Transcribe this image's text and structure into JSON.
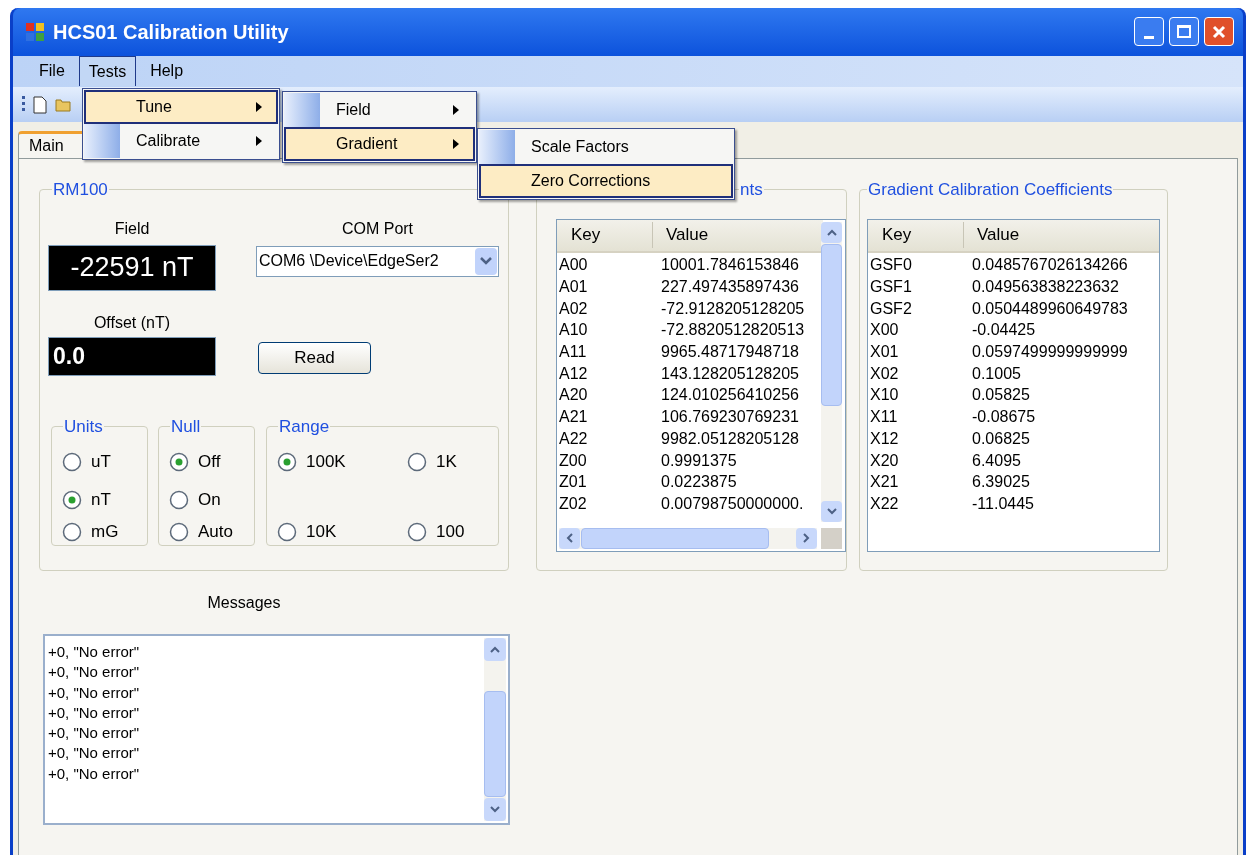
{
  "window": {
    "title": "HCS01 Calibration Utility"
  },
  "menu_bar": [
    {
      "label": "File",
      "selected": false
    },
    {
      "label": "Tests",
      "selected": true
    },
    {
      "label": "Help",
      "selected": false
    }
  ],
  "open_menus": [
    {
      "items": [
        {
          "label": "Tune",
          "selected": true,
          "submenu": true
        },
        {
          "label": "Calibrate",
          "selected": false,
          "submenu": true
        }
      ]
    },
    {
      "items": [
        {
          "label": "Field",
          "selected": false,
          "submenu": true
        },
        {
          "label": "Gradient",
          "selected": true,
          "submenu": true
        }
      ]
    },
    {
      "items": [
        {
          "label": "Scale Factors",
          "selected": false,
          "submenu": false
        },
        {
          "label": "Zero Corrections",
          "selected": true,
          "submenu": false
        }
      ]
    }
  ],
  "tabs": [
    {
      "label": "Main",
      "selected": true
    }
  ],
  "rm100": {
    "title": "RM100",
    "field_label": "Field",
    "field_value": "-22591 nT",
    "com_port_label": "COM Port",
    "com_port_value": "COM6 \\Device\\EdgeSer2",
    "offset_label": "Offset (nT)",
    "offset_value": "0.0",
    "read_button": "Read",
    "groups": [
      {
        "title": "Units",
        "options": [
          {
            "label": "uT",
            "selected": false
          },
          {
            "label": "nT",
            "selected": true
          },
          {
            "label": "mG",
            "selected": false
          }
        ]
      },
      {
        "title": "Null",
        "options": [
          {
            "label": "Off",
            "selected": true
          },
          {
            "label": "On",
            "selected": false
          },
          {
            "label": "Auto",
            "selected": false
          }
        ]
      },
      {
        "title": "Range",
        "options": [
          {
            "label": "100K",
            "selected": true
          },
          {
            "label": "1K",
            "selected": false
          },
          {
            "label": "10K",
            "selected": false
          },
          {
            "label": "100",
            "selected": false
          }
        ]
      }
    ]
  },
  "field_coefficients": {
    "title": "nts",
    "columns": [
      "Key",
      "Value"
    ],
    "rows": [
      [
        "A00",
        "10001.7846153846"
      ],
      [
        "A01",
        "227.497435897436"
      ],
      [
        "A02",
        "-72.9128205128205"
      ],
      [
        "A10",
        "-72.8820512820513"
      ],
      [
        "A11",
        "9965.48717948718"
      ],
      [
        "A12",
        "143.128205128205"
      ],
      [
        "A20",
        "124.010256410256"
      ],
      [
        "A21",
        "106.769230769231"
      ],
      [
        "A22",
        "9982.05128205128"
      ],
      [
        "Z00",
        "0.9991375"
      ],
      [
        "Z01",
        "0.0223875"
      ],
      [
        "Z02",
        "0.00798750000000."
      ]
    ]
  },
  "gradient_coefficients": {
    "title": "Gradient Calibration Coefficients",
    "columns": [
      "Key",
      "Value"
    ],
    "rows": [
      [
        "GSF0",
        "0.0485767026134266"
      ],
      [
        "GSF1",
        "0.049563838223632"
      ],
      [
        "GSF2",
        "0.0504489960649783"
      ],
      [
        "X00",
        "-0.04425"
      ],
      [
        "X01",
        "0.0597499999999999"
      ],
      [
        "X02",
        "0.1005"
      ],
      [
        "X10",
        "0.05825"
      ],
      [
        "X11",
        "-0.08675"
      ],
      [
        "X12",
        "0.06825"
      ],
      [
        "X20",
        "6.4095"
      ],
      [
        "X21",
        "6.39025"
      ],
      [
        "X22",
        "-11.0445"
      ]
    ]
  },
  "messages": {
    "label": "Messages",
    "lines": [
      "+0, \"No error\"",
      "+0, \"No error\"",
      "+0, \"No error\"",
      "+0, \"No error\"",
      "+0, \"No error\"",
      "+0, \"No error\"",
      "+0, \"No error\""
    ]
  }
}
